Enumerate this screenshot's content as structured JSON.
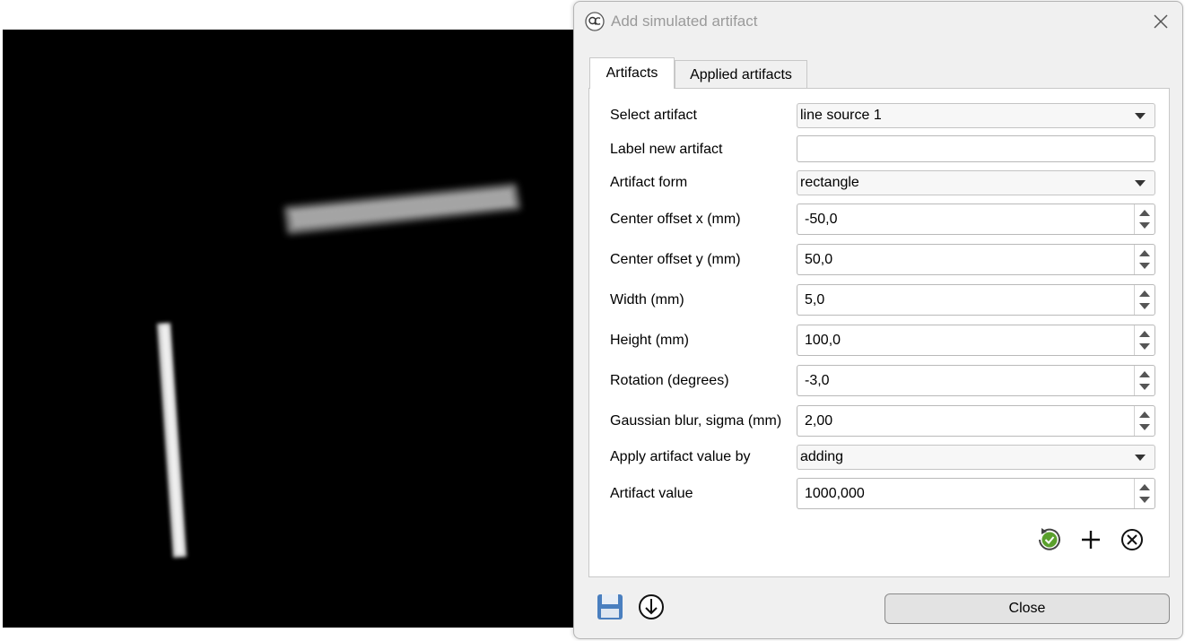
{
  "dialog": {
    "title": "Add simulated artifact",
    "tabs": [
      {
        "label": "Artifacts",
        "active": true
      },
      {
        "label": "Applied artifacts",
        "active": false
      }
    ],
    "fields": {
      "select_artifact": {
        "label": "Select artifact",
        "value": "line source 1"
      },
      "label_new_artifact": {
        "label": "Label new artifact",
        "value": ""
      },
      "artifact_form": {
        "label": "Artifact form",
        "value": "rectangle"
      },
      "center_offset_x": {
        "label": "Center offset x (mm)",
        "value": "-50,0"
      },
      "center_offset_y": {
        "label": "Center offset y (mm)",
        "value": "50,0"
      },
      "width": {
        "label": "Width (mm)",
        "value": "5,0"
      },
      "height": {
        "label": "Height (mm)",
        "value": "100,0"
      },
      "rotation": {
        "label": "Rotation (degrees)",
        "value": "-3,0"
      },
      "gaussian_blur": {
        "label": "Gaussian blur, sigma (mm)",
        "value": "2,00"
      },
      "apply_by": {
        "label": "Apply artifact value by",
        "value": "adding"
      },
      "artifact_value": {
        "label": "Artifact value",
        "value": "1000,000"
      }
    },
    "close_label": "Close"
  },
  "icons": {
    "app": "qc-logo-icon",
    "window_close": "close-icon",
    "apply": "refresh-check-icon",
    "add": "plus-icon",
    "delete": "circle-x-icon",
    "save": "floppy-disk-icon",
    "load": "download-arrow-icon"
  },
  "colors": {
    "dialog_bg": "#f0f0f0",
    "panel_bg": "#ffffff",
    "viewer_bg": "#000000",
    "title_text": "#9a9a9a",
    "save_icon": "#4a7fbf",
    "apply_icon": "#5aa02c"
  }
}
